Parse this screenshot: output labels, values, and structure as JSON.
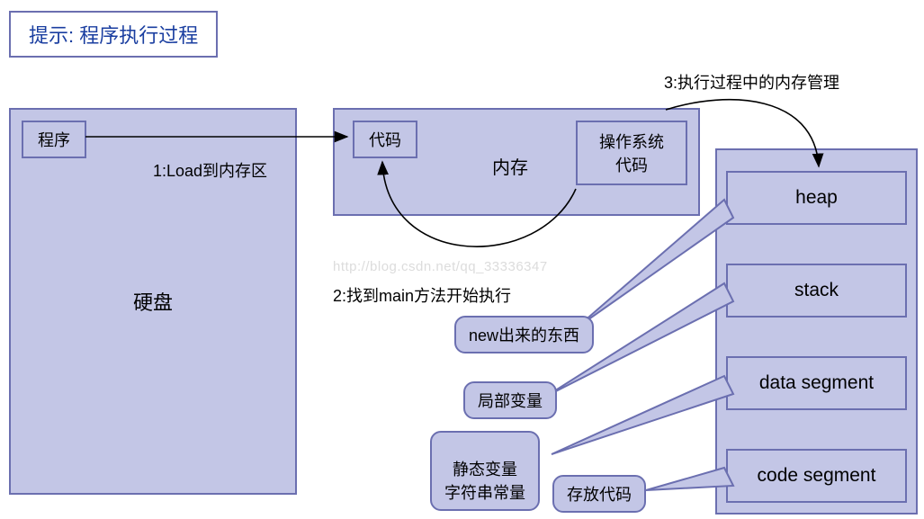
{
  "title": "提示: 程序执行过程",
  "disk": {
    "label": "硬盘",
    "program": "程序"
  },
  "memory": {
    "label": "内存",
    "code": "代码",
    "os_code": "操作系统\n代码"
  },
  "segments": {
    "heap": "heap",
    "stack": "stack",
    "data": "data segment",
    "code": "code segment"
  },
  "steps": {
    "s1": "1:Load到内存区",
    "s2": "2:找到main方法开始执行",
    "s3": "3:执行过程中的内存管理"
  },
  "bubbles": {
    "heap": "new出来的东西",
    "stack": "局部变量",
    "data": "静态变量\n字符串常量",
    "code": "存放代码"
  },
  "watermark": "http://blog.csdn.net/qq_33336347"
}
